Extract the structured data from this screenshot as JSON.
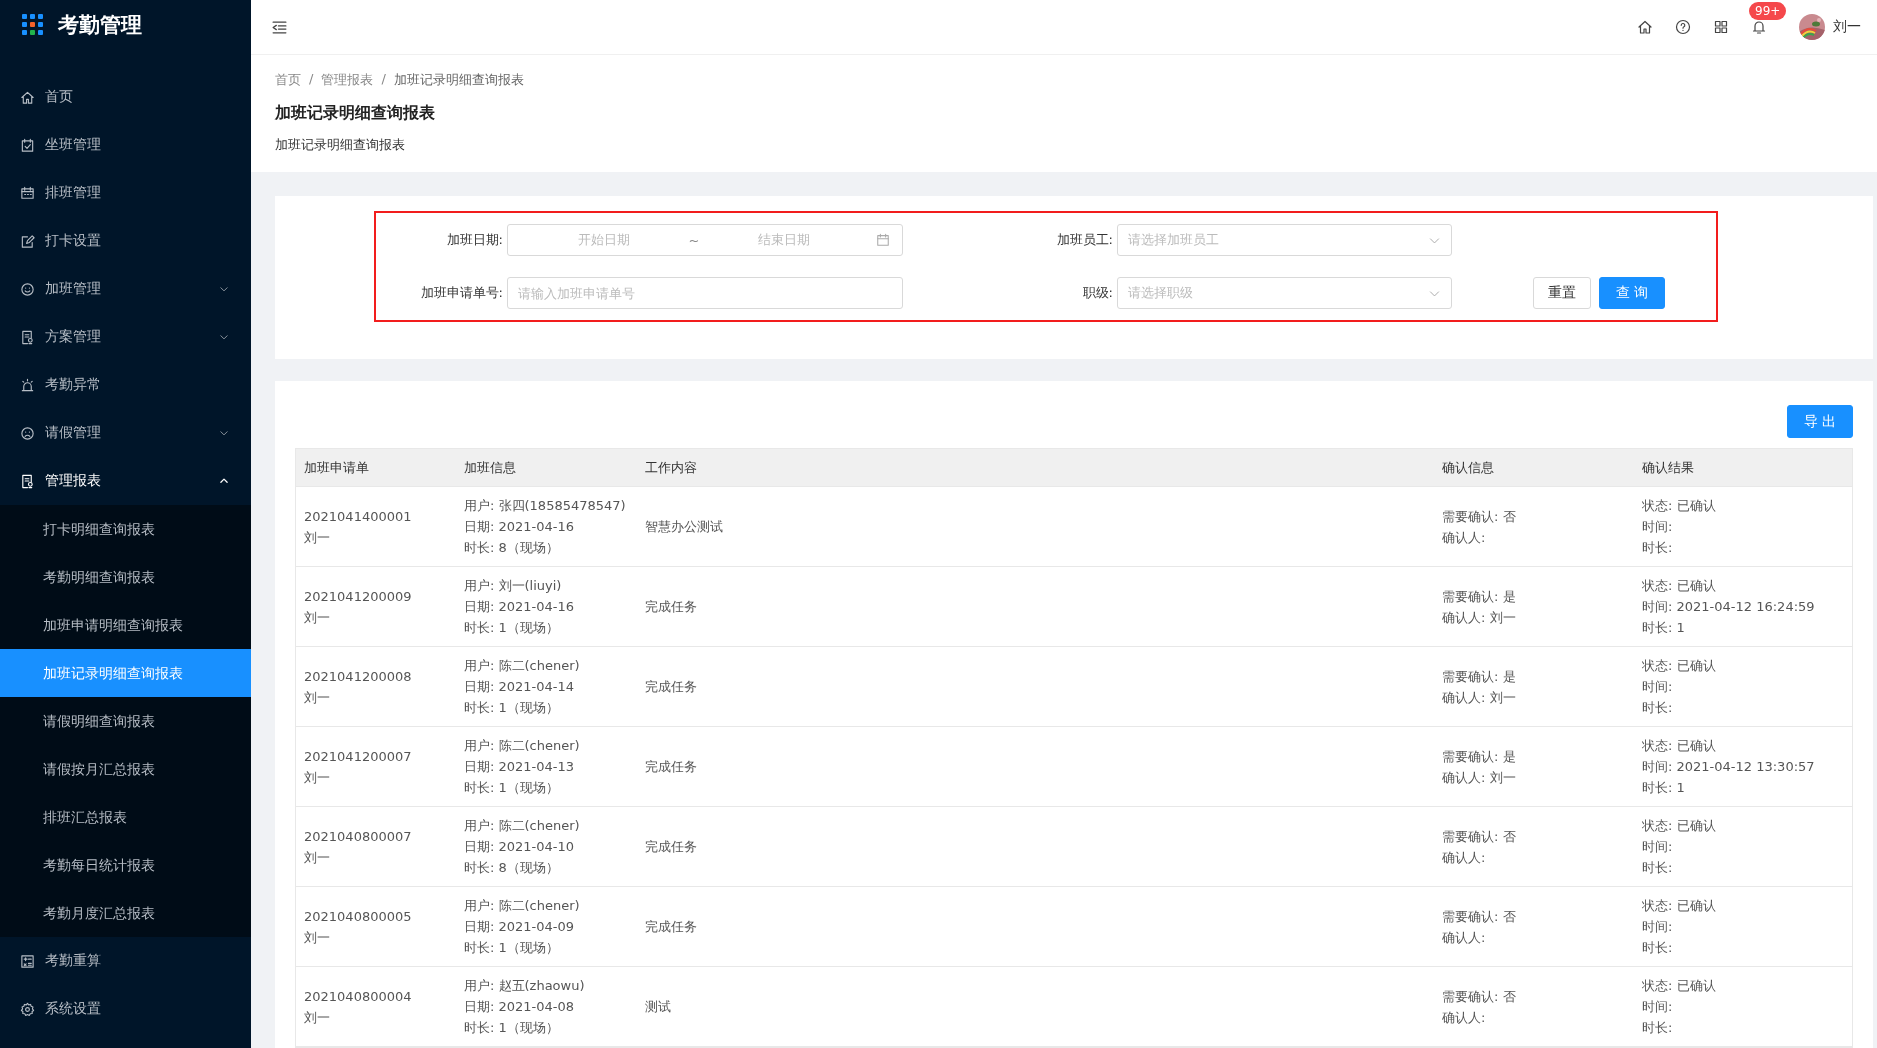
{
  "app": {
    "title": "考勤管理"
  },
  "sidebar": {
    "items": [
      {
        "label": "首页",
        "selected": false
      },
      {
        "label": "坐班管理",
        "selected": false
      },
      {
        "label": "排班管理",
        "selected": false
      },
      {
        "label": "打卡设置",
        "selected": false
      },
      {
        "label": "加班管理",
        "selected": false,
        "expanded": false
      },
      {
        "label": "方案管理",
        "selected": false,
        "expanded": false
      },
      {
        "label": "考勤异常",
        "selected": false
      },
      {
        "label": "请假管理",
        "selected": false,
        "expanded": false
      },
      {
        "label": "管理报表",
        "selected": false,
        "expanded": true,
        "children": [
          {
            "label": "打卡明细查询报表",
            "selected": false
          },
          {
            "label": "考勤明细查询报表",
            "selected": false
          },
          {
            "label": "加班申请明细查询报表",
            "selected": false
          },
          {
            "label": "加班记录明细查询报表",
            "selected": true
          },
          {
            "label": "请假明细查询报表",
            "selected": false
          },
          {
            "label": "请假按月汇总报表",
            "selected": false
          },
          {
            "label": "排班汇总报表",
            "selected": false
          },
          {
            "label": "考勤每日统计报表",
            "selected": false
          },
          {
            "label": "考勤月度汇总报表",
            "selected": false
          }
        ]
      },
      {
        "label": "考勤重算",
        "selected": false
      },
      {
        "label": "系统设置",
        "selected": false
      }
    ]
  },
  "header": {
    "notification_badge": "99+",
    "user": "刘一"
  },
  "breadcrumb": {
    "separator": "/",
    "items": [
      "首页",
      "管理报表",
      "加班记录明细查询报表"
    ]
  },
  "page": {
    "title": "加班记录明细查询报表",
    "subtitle": "加班记录明细查询报表"
  },
  "filter": {
    "highlighted": true,
    "date_label": "加班日期:",
    "start_placeholder": "开始日期",
    "separator": "~",
    "end_placeholder": "结束日期",
    "employee_label": "加班员工:",
    "employee_placeholder": "请选择加班员工",
    "number_label": "加班申请单号:",
    "number_placeholder": "请输入加班申请单号",
    "level_label": "职级:",
    "level_placeholder": "请选择职级",
    "buttons": [
      {
        "label": "重置",
        "kind": "default"
      },
      {
        "label": "查 询",
        "kind": "primary"
      }
    ]
  },
  "export_button": "导 出",
  "table": {
    "columns": [
      "加班申请单",
      "加班信息",
      "工作内容",
      "确认信息",
      "确认结果"
    ],
    "rows": [
      [
        [
          "2021041400001",
          "刘一"
        ],
        [
          "用户: 张四(18585478547)",
          "日期: 2021-04-16",
          "时长: 8（现场）"
        ],
        [
          "智慧办公测试"
        ],
        [
          "需要确认: 否",
          "确认人:"
        ],
        [
          "状态: 已确认",
          "时间:",
          "时长:"
        ]
      ],
      [
        [
          "2021041200009",
          "刘一"
        ],
        [
          "用户: 刘一(liuyi)",
          "日期: 2021-04-16",
          "时长: 1（现场）"
        ],
        [
          "完成任务"
        ],
        [
          "需要确认: 是",
          "确认人: 刘一"
        ],
        [
          "状态: 已确认",
          "时间: 2021-04-12 16:24:59",
          "时长: 1"
        ]
      ],
      [
        [
          "2021041200008",
          "刘一"
        ],
        [
          "用户: 陈二(chener)",
          "日期: 2021-04-14",
          "时长: 1（现场）"
        ],
        [
          "完成任务"
        ],
        [
          "需要确认: 是",
          "确认人: 刘一"
        ],
        [
          "状态: 已确认",
          "时间:",
          "时长:"
        ]
      ],
      [
        [
          "2021041200007",
          "刘一"
        ],
        [
          "用户: 陈二(chener)",
          "日期: 2021-04-13",
          "时长: 1（现场）"
        ],
        [
          "完成任务"
        ],
        [
          "需要确认: 是",
          "确认人: 刘一"
        ],
        [
          "状态: 已确认",
          "时间: 2021-04-12 13:30:57",
          "时长: 1"
        ]
      ],
      [
        [
          "2021040800007",
          "刘一"
        ],
        [
          "用户: 陈二(chener)",
          "日期: 2021-04-10",
          "时长: 8（现场）"
        ],
        [
          "完成任务"
        ],
        [
          "需要确认: 否",
          "确认人:"
        ],
        [
          "状态: 已确认",
          "时间:",
          "时长:"
        ]
      ],
      [
        [
          "2021040800005",
          "刘一"
        ],
        [
          "用户: 陈二(chener)",
          "日期: 2021-04-09",
          "时长: 1（现场）"
        ],
        [
          "完成任务"
        ],
        [
          "需要确认: 否",
          "确认人:"
        ],
        [
          "状态: 已确认",
          "时间:",
          "时长:"
        ]
      ],
      [
        [
          "2021040800004",
          "刘一"
        ],
        [
          "用户: 赵五(zhaowu)",
          "日期: 2021-04-08",
          "时长: 1（现场）"
        ],
        [
          "测试"
        ],
        [
          "需要确认: 否",
          "确认人:"
        ],
        [
          "状态: 已确认",
          "时间:",
          "时长:"
        ]
      ]
    ]
  }
}
